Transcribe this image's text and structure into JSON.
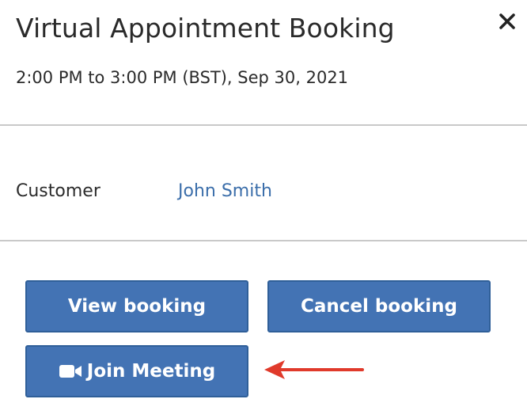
{
  "dialog": {
    "title": "Virtual Appointment Booking",
    "subtitle": "2:00 PM to 3:00 PM (BST), Sep 30, 2021",
    "close_icon": "close-icon"
  },
  "customer": {
    "label": "Customer",
    "name": "John Smith"
  },
  "actions": {
    "view_label": "View booking",
    "cancel_label": "Cancel booking",
    "join_label": "Join Meeting",
    "join_icon": "video-camera-icon"
  },
  "annotation": {
    "arrow_icon": "arrow-left-icon",
    "arrow_color": "#e03a2b"
  },
  "colors": {
    "button_bg": "#4373b4",
    "link": "#3b6eaa"
  }
}
